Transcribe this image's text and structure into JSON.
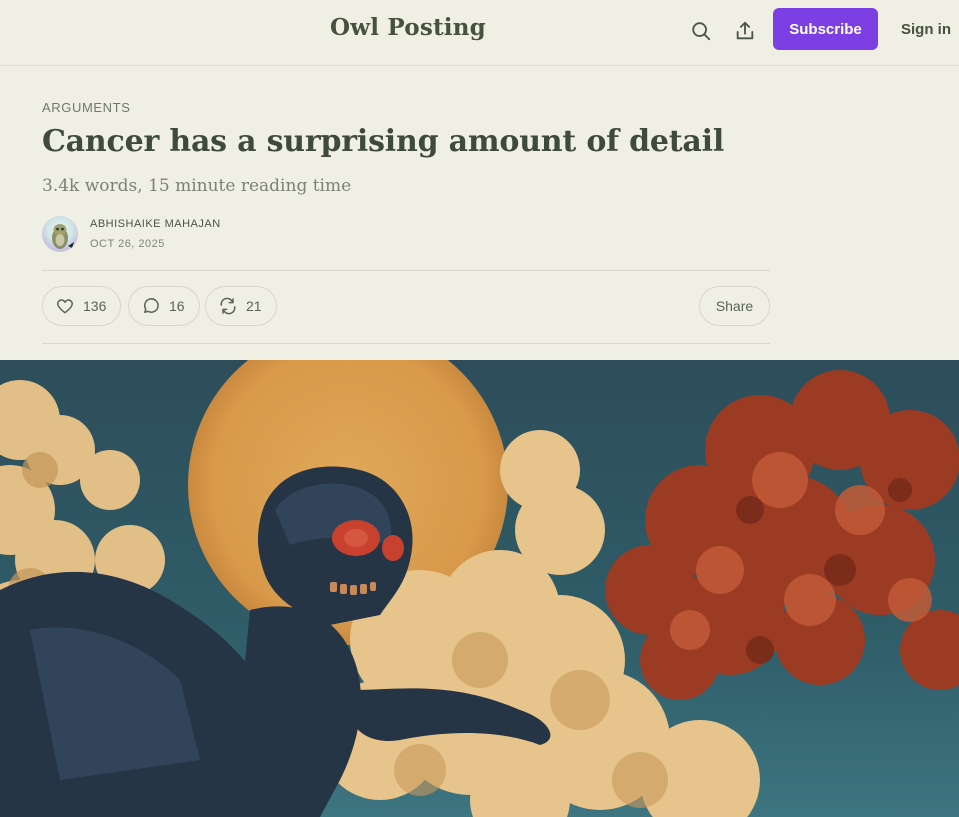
{
  "header": {
    "site_title": "Owl Posting",
    "subscribe_label": "Subscribe",
    "signin_label": "Sign in",
    "icons": [
      "search-icon",
      "share-icon"
    ],
    "accent_color": "#7b3fe4"
  },
  "post": {
    "section": "ARGUMENTS",
    "title": "Cancer has a surprising amount of detail",
    "subtitle": "3.4k words, 15 minute reading time",
    "author": "ABHISHAIKE MAHAJAN",
    "date": "OCT 26, 2025"
  },
  "actions": {
    "likes": "136",
    "comments": "16",
    "restacks": "21",
    "share_label": "Share"
  }
}
